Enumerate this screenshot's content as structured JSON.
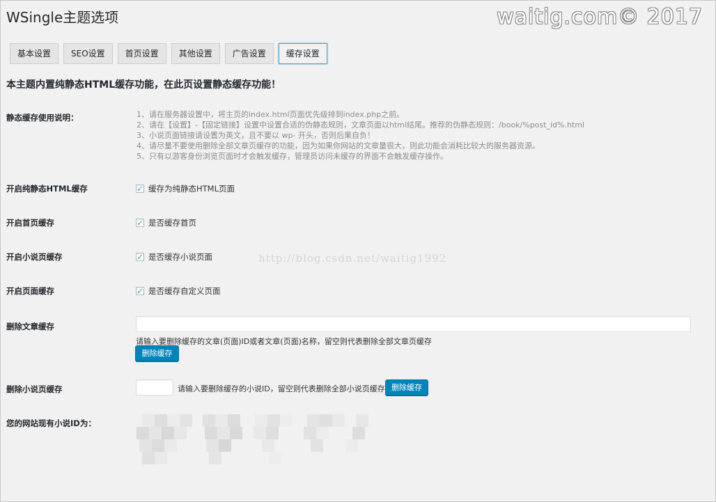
{
  "page": {
    "title": "WSingle主题选项",
    "watermark_top": "waitig.com© 2017",
    "watermark_mid": "http://blog.csdn.net/waitig1992"
  },
  "tabs": [
    {
      "label": "基本设置",
      "active": false
    },
    {
      "label": "SEO设置",
      "active": false
    },
    {
      "label": "首页设置",
      "active": false
    },
    {
      "label": "其他设置",
      "active": false
    },
    {
      "label": "广告设置",
      "active": false
    },
    {
      "label": "缓存设置",
      "active": true
    }
  ],
  "intro": "本主题内置纯静态HTML缓存功能，在此页设置静态缓存功能！",
  "usage": {
    "label": "静态缓存使用说明：",
    "lines": [
      "1、请在服务器设置中，将主页的index.html页面优先级排到index.php之前。",
      "2、请在【设置】-【固定链接】设置中设置合适的伪静态规则，文章页面以html结尾。推荐的伪静态规则：/book/%post_id%.html",
      "3、小说页面链接请设置为英文，且不要以 wp- 开头，否则后果自负！",
      "4、请尽量不要使用删除全部文章页缓存的功能，因为如果你网站的文章量很大，则此功能会消耗比较大的服务器资源。",
      "5、只有以游客身份浏览页面时才会触发缓存，管理员访问未缓存的界面不会触发缓存操作。"
    ]
  },
  "options": [
    {
      "label": "开启纯静态HTML缓存",
      "checkbox_text": "缓存为纯静态HTML页面",
      "checked": true
    },
    {
      "label": "开启首页缓存",
      "checkbox_text": "是否缓存首页",
      "checked": true
    },
    {
      "label": "开启小说页缓存",
      "checkbox_text": "是否缓存小说页面",
      "checked": true
    },
    {
      "label": "开启页面缓存",
      "checkbox_text": "是否缓存自定义页面",
      "checked": true
    }
  ],
  "delete_post_cache": {
    "label": "删除文章缓存",
    "input_value": "",
    "description": "请输入要删除缓存的文章(页面)ID或者文章(页面)名称，留空则代表删除全部文章页缓存",
    "button": "删除缓存"
  },
  "delete_novel_cache": {
    "label": "删除小说页缓存",
    "input_value": "",
    "description": "请输入要删除缓存的小说ID，留空则代表删除全部小说页缓存",
    "button": "删除缓存"
  },
  "novel_ids": {
    "label": "您的网站现有小说ID为："
  },
  "colors": {
    "primary_button": "#0085ba",
    "tab_active_border": "#5b9dd9",
    "background": "#f1f1f1"
  }
}
